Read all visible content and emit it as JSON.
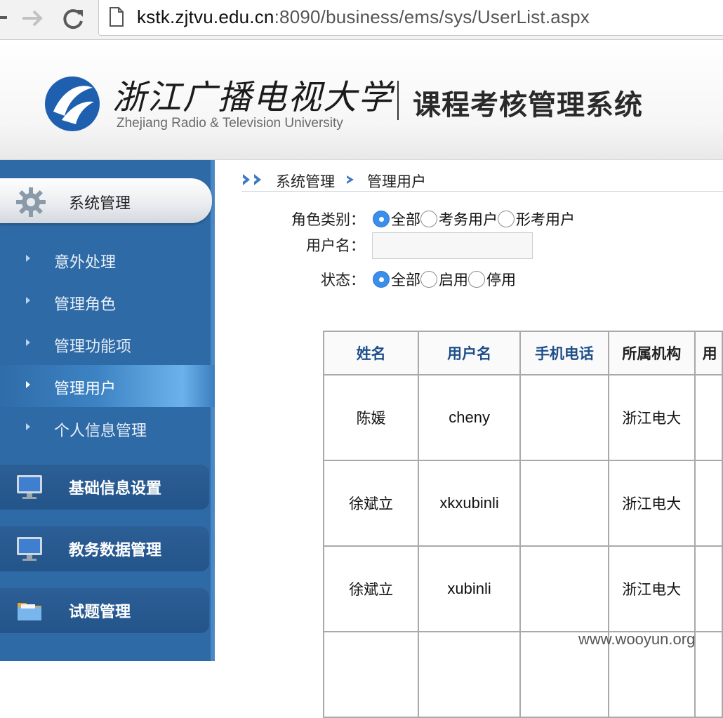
{
  "browser": {
    "url_host": "kstk.zjtvu.edu.cn",
    "url_rest": ":8090/business/ems/sys/UserList.aspx"
  },
  "header": {
    "university_cn": "浙江广播电视大学",
    "university_en": "Zhejiang Radio & Television University",
    "system_title": "课程考核管理系统"
  },
  "sidebar": {
    "active_group": {
      "label": "系统管理",
      "icon": "gear-icon"
    },
    "sub_items": [
      {
        "label": "意外处理",
        "active": false
      },
      {
        "label": "管理角色",
        "active": false
      },
      {
        "label": "管理功能项",
        "active": false
      },
      {
        "label": "管理用户",
        "active": true
      },
      {
        "label": "个人信息管理",
        "active": false
      }
    ],
    "groups": [
      {
        "label": "基础信息设置",
        "icon": "monitor-icon"
      },
      {
        "label": "教务数据管理",
        "icon": "monitor-icon"
      },
      {
        "label": "试题管理",
        "icon": "folder-icon"
      }
    ]
  },
  "breadcrumb": {
    "root": "系统管理",
    "leaf": "管理用户"
  },
  "filters": {
    "role": {
      "label": "角色类别：",
      "options": [
        "全部",
        "考务用户",
        "形考用户"
      ],
      "selected": "全部"
    },
    "username": {
      "label": "用户名：",
      "value": ""
    },
    "status": {
      "label": "状态：",
      "options": [
        "全部",
        "启用",
        "停用"
      ],
      "selected": "全部"
    }
  },
  "table": {
    "columns": [
      "姓名",
      "用户名",
      "手机电话",
      "所属机构",
      "用"
    ],
    "rows": [
      [
        "陈媛",
        "cheny",
        "",
        "浙江电大",
        ""
      ],
      [
        "徐斌立",
        "xkxubinli",
        "",
        "浙江电大",
        ""
      ],
      [
        "徐斌立",
        "xubinli",
        "",
        "浙江电大",
        ""
      ],
      [
        "",
        "",
        "",
        "",
        ""
      ]
    ]
  },
  "watermark": "www.wooyun.org",
  "colors": {
    "sidebar_bg": "#2e6aa6",
    "radio_selected": "#3b8fea",
    "header_link_blue": "#1f4f8a"
  }
}
